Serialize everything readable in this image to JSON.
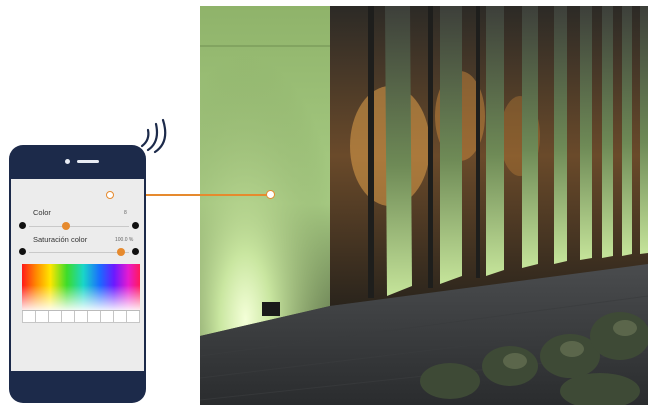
{
  "app": {
    "controls": {
      "color": {
        "label": "Color",
        "value": "8",
        "level": 0.38
      },
      "saturation": {
        "label": "Saturación color",
        "value": "100.0 %",
        "level": 1.0
      }
    },
    "palette": {
      "swatch_count": 9
    }
  },
  "icons": {
    "signal": "wifi-signal-icon",
    "camera": "front-camera-icon",
    "speaker": "speaker-icon"
  },
  "colors": {
    "accent": "#e68a2e",
    "phone_frame": "#1c2a4a",
    "screen_bg": "#ececec",
    "facade_light": "#9fc27a"
  }
}
